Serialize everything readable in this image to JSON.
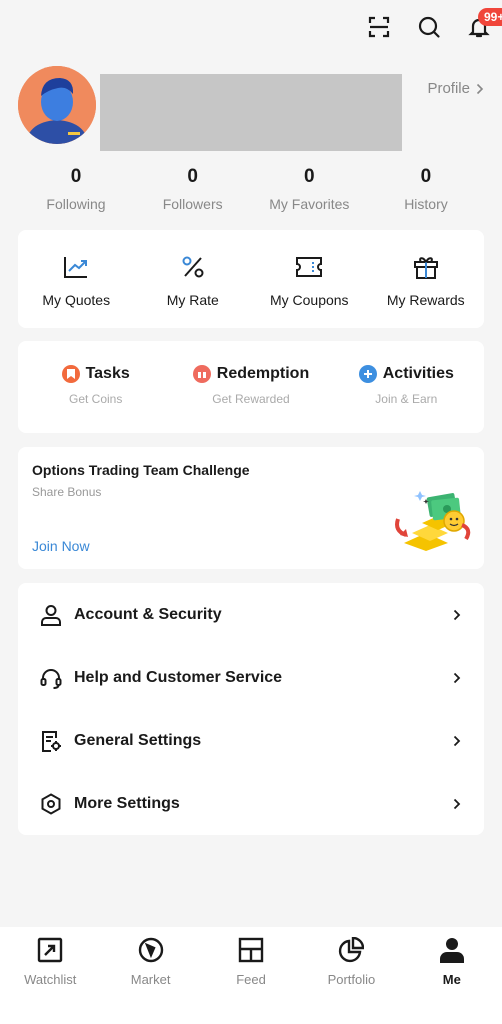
{
  "header": {
    "notification_badge": "99+"
  },
  "profile": {
    "link_label": "Profile"
  },
  "stats": [
    {
      "value": "0",
      "label": "Following"
    },
    {
      "value": "0",
      "label": "Followers"
    },
    {
      "value": "0",
      "label": "My Favorites"
    },
    {
      "value": "0",
      "label": "History"
    }
  ],
  "tools": [
    {
      "label": "My Quotes",
      "icon": "chart-icon"
    },
    {
      "label": "My Rate",
      "icon": "percent-icon"
    },
    {
      "label": "My Coupons",
      "icon": "coupon-icon"
    },
    {
      "label": "My Rewards",
      "icon": "gift-icon"
    }
  ],
  "rewards": [
    {
      "title": "Tasks",
      "subtitle": "Get Coins",
      "color": "#f26a3d"
    },
    {
      "title": "Redemption",
      "subtitle": "Get Rewarded",
      "color": "#ef6b5e"
    },
    {
      "title": "Activities",
      "subtitle": "Join & Earn",
      "color": "#3d8fe0"
    }
  ],
  "challenge": {
    "title": "Options Trading Team Challenge",
    "subtitle": "Share Bonus",
    "cta": "Join Now"
  },
  "settings": [
    {
      "label": "Account & Security",
      "icon": "user-icon"
    },
    {
      "label": "Help and Customer Service",
      "icon": "headset-icon"
    },
    {
      "label": "General Settings",
      "icon": "settings-doc-icon"
    },
    {
      "label": "More Settings",
      "icon": "hexagon-gear-icon"
    }
  ],
  "bottom_nav": [
    {
      "label": "Watchlist",
      "active": false
    },
    {
      "label": "Market",
      "active": false
    },
    {
      "label": "Feed",
      "active": false
    },
    {
      "label": "Portfolio",
      "active": false
    },
    {
      "label": "Me",
      "active": true
    }
  ],
  "colors": {
    "accent_blue": "#3a88d6",
    "badge_red": "#f0453a",
    "avatar_bg": "#f08a5d"
  }
}
